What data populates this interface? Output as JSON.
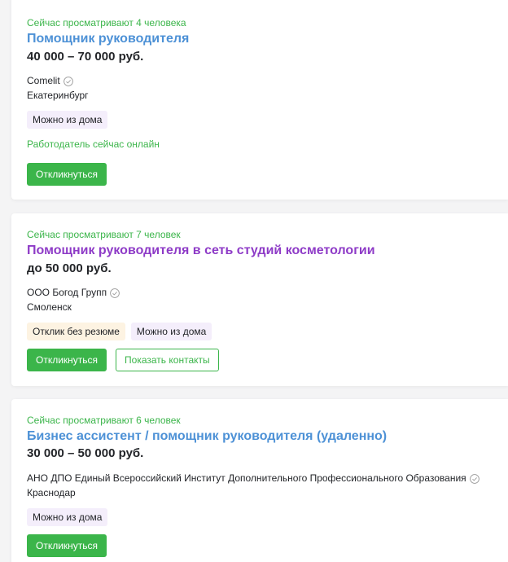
{
  "vacancies": [
    {
      "viewers": "Сейчас просматривают 4 человека",
      "title": "Помощник руководителя",
      "salary": "40 000 – 70 000 руб.",
      "company": "Comelit",
      "city": "Екатеринбург",
      "tags": [
        "Можно из дома"
      ],
      "employer_online": "Работодатель сейчас онлайн",
      "respond_label": "Откликнуться"
    },
    {
      "viewers": "Сейчас просматривают 7 человек",
      "title": "Помощник руководителя в сеть студий косметологии",
      "salary": "до 50 000 руб.",
      "company": "ООО Богод Групп",
      "city": "Смоленск",
      "tags": [
        "Отклик без резюме",
        "Можно из дома"
      ],
      "respond_label": "Откликнуться",
      "contacts_label": "Показать контакты"
    },
    {
      "viewers": "Сейчас просматривают 6 человек",
      "title": "Бизнес ассистент / помощник руководителя (удаленно)",
      "salary": "30 000 – 50 000 руб.",
      "company": "АНО ДПО Единый Всероссийский Институт Дополнительного Профессионального Образования",
      "city": "Краснодар",
      "tags": [
        "Можно из дома"
      ],
      "respond_label": "Откликнуться"
    }
  ],
  "colors": {
    "accent_green": "#3bb54a",
    "link_blue": "#4d91d6",
    "link_visited": "#8e3bc7",
    "tag_remote_bg": "#f4eefb",
    "tag_noresume_bg": "#fdf3e2"
  },
  "icons": {
    "verified": "verified-check-icon"
  }
}
